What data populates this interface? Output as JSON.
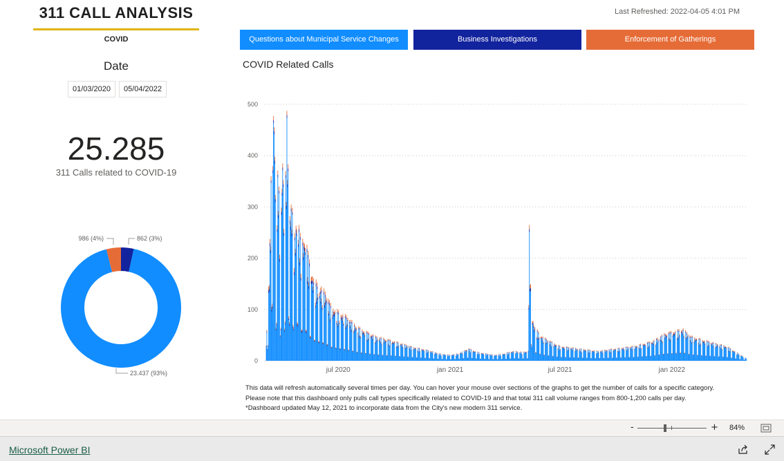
{
  "report": {
    "title": "311 CALL ANALYSIS",
    "subtitle": "COVID",
    "last_refreshed": "Last Refreshed: 2022-04-05 4:01 PM",
    "date_filter": {
      "label": "Date",
      "start": "01/03/2020",
      "end": "05/04/2022"
    },
    "kpi": {
      "value": "25.285",
      "label": "311 Calls related to COVID-19"
    },
    "buttons": [
      {
        "label": "Questions about Municipal Service Changes",
        "color": "#118dff"
      },
      {
        "label": "Business Investigations",
        "color": "#12239e"
      },
      {
        "label": "Enforcement of Gatherings",
        "color": "#e66c37"
      }
    ],
    "notes": [
      "This data will refresh automatically several times per day. You can hover your mouse over sections of the graphs to get the number of calls for a specific category.",
      "Please note that this dashboard only pulls call types specifically related to COVID-19 and that total 311 call volume ranges from 800-1,200 calls per day.",
      "*Dashboard updated May 12, 2021 to incorporate data from the City's new modern 311 service."
    ]
  },
  "footer": {
    "link": "Microsoft Power BI",
    "zoom": "84%",
    "zoom_minus": "-",
    "zoom_plus": "+"
  },
  "chart_data": [
    {
      "type": "pie",
      "subtype": "donut",
      "labels": [
        "Questions about Municipal Service Changes",
        "Enforcement of Gatherings",
        "Business Investigations"
      ],
      "values": [
        23437,
        986,
        862
      ],
      "data_labels": [
        "23.437 (93%)",
        "986 (4%)",
        "862 (3%)"
      ],
      "colors": [
        "#118dff",
        "#e66c37",
        "#12239e"
      ]
    },
    {
      "type": "bar",
      "stacked": true,
      "title": "COVID Related Calls",
      "xlabel": "",
      "ylabel": "",
      "x_ticks": [
        "jul 2020",
        "jan 2021",
        "jul 2021",
        "jan 2022"
      ],
      "y_ticks": [
        "0",
        "100",
        "200",
        "300",
        "400",
        "500"
      ],
      "ylim": [
        0,
        520
      ],
      "grid": true,
      "x_start": "2020-03-01",
      "x_end": "2022-05-04",
      "series": [
        {
          "name": "Questions about Municipal Service Changes",
          "color": "#118dff"
        },
        {
          "name": "Business Investigations",
          "color": "#12239e"
        },
        {
          "name": "Enforcement of Gatherings",
          "color": "#e66c37"
        }
      ],
      "points": [
        [
          "2020-03-05",
          35
        ],
        [
          "2020-03-10",
          180
        ],
        [
          "2020-03-14",
          420
        ],
        [
          "2020-03-18",
          520
        ],
        [
          "2020-03-21",
          260
        ],
        [
          "2020-03-25",
          410
        ],
        [
          "2020-03-28",
          200
        ],
        [
          "2020-04-01",
          430
        ],
        [
          "2020-04-04",
          250
        ],
        [
          "2020-04-08",
          490
        ],
        [
          "2020-04-12",
          300
        ],
        [
          "2020-04-16",
          320
        ],
        [
          "2020-04-20",
          240
        ],
        [
          "2020-04-25",
          300
        ],
        [
          "2020-05-01",
          240
        ],
        [
          "2020-05-08",
          250
        ],
        [
          "2020-05-15",
          200
        ],
        [
          "2020-05-22",
          165
        ],
        [
          "2020-06-01",
          150
        ],
        [
          "2020-06-10",
          140
        ],
        [
          "2020-06-20",
          110
        ],
        [
          "2020-07-01",
          100
        ],
        [
          "2020-07-15",
          90
        ],
        [
          "2020-08-01",
          70
        ],
        [
          "2020-08-15",
          60
        ],
        [
          "2020-09-01",
          50
        ],
        [
          "2020-09-15",
          45
        ],
        [
          "2020-10-01",
          40
        ],
        [
          "2020-10-15",
          35
        ],
        [
          "2020-11-01",
          28
        ],
        [
          "2020-11-15",
          25
        ],
        [
          "2020-12-01",
          20
        ],
        [
          "2020-12-15",
          15
        ],
        [
          "2021-01-01",
          12
        ],
        [
          "2021-01-15",
          15
        ],
        [
          "2021-02-01",
          25
        ],
        [
          "2021-02-15",
          18
        ],
        [
          "2021-03-01",
          15
        ],
        [
          "2021-03-15",
          12
        ],
        [
          "2021-04-01",
          15
        ],
        [
          "2021-04-15",
          20
        ],
        [
          "2021-05-01",
          18
        ],
        [
          "2021-05-10",
          20
        ],
        [
          "2021-05-12",
          265
        ],
        [
          "2021-05-14",
          150
        ],
        [
          "2021-05-17",
          90
        ],
        [
          "2021-05-20",
          70
        ],
        [
          "2021-06-01",
          50
        ],
        [
          "2021-06-15",
          40
        ],
        [
          "2021-07-01",
          30
        ],
        [
          "2021-08-01",
          25
        ],
        [
          "2021-09-01",
          20
        ],
        [
          "2021-10-01",
          25
        ],
        [
          "2021-11-01",
          30
        ],
        [
          "2021-12-01",
          40
        ],
        [
          "2021-12-20",
          55
        ],
        [
          "2022-01-05",
          60
        ],
        [
          "2022-01-20",
          65
        ],
        [
          "2022-02-01",
          50
        ],
        [
          "2022-03-01",
          40
        ],
        [
          "2022-04-01",
          30
        ],
        [
          "2022-05-04",
          5
        ]
      ]
    }
  ]
}
